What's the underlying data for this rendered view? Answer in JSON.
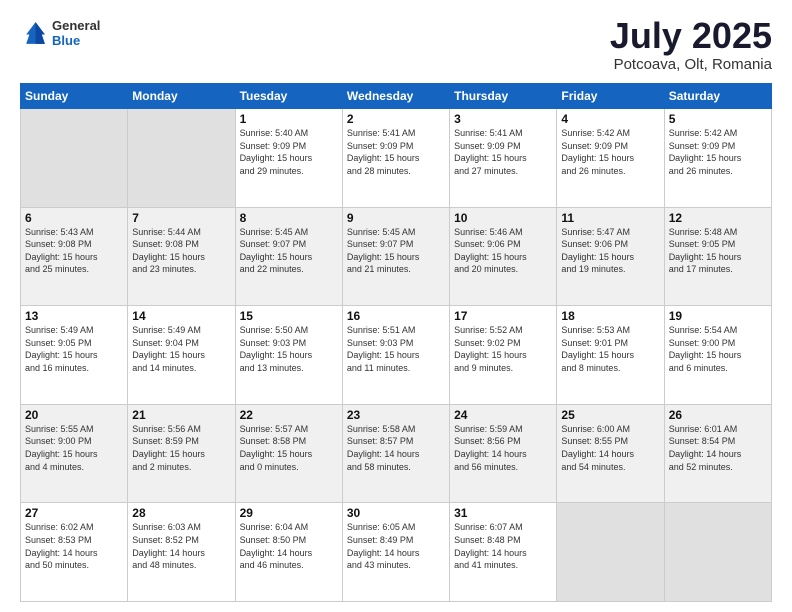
{
  "header": {
    "logo_general": "General",
    "logo_blue": "Blue",
    "month": "July 2025",
    "location": "Potcoava, Olt, Romania"
  },
  "weekdays": [
    "Sunday",
    "Monday",
    "Tuesday",
    "Wednesday",
    "Thursday",
    "Friday",
    "Saturday"
  ],
  "weeks": [
    [
      {
        "day": "",
        "info": ""
      },
      {
        "day": "",
        "info": ""
      },
      {
        "day": "1",
        "info": "Sunrise: 5:40 AM\nSunset: 9:09 PM\nDaylight: 15 hours\nand 29 minutes."
      },
      {
        "day": "2",
        "info": "Sunrise: 5:41 AM\nSunset: 9:09 PM\nDaylight: 15 hours\nand 28 minutes."
      },
      {
        "day": "3",
        "info": "Sunrise: 5:41 AM\nSunset: 9:09 PM\nDaylight: 15 hours\nand 27 minutes."
      },
      {
        "day": "4",
        "info": "Sunrise: 5:42 AM\nSunset: 9:09 PM\nDaylight: 15 hours\nand 26 minutes."
      },
      {
        "day": "5",
        "info": "Sunrise: 5:42 AM\nSunset: 9:09 PM\nDaylight: 15 hours\nand 26 minutes."
      }
    ],
    [
      {
        "day": "6",
        "info": "Sunrise: 5:43 AM\nSunset: 9:08 PM\nDaylight: 15 hours\nand 25 minutes."
      },
      {
        "day": "7",
        "info": "Sunrise: 5:44 AM\nSunset: 9:08 PM\nDaylight: 15 hours\nand 23 minutes."
      },
      {
        "day": "8",
        "info": "Sunrise: 5:45 AM\nSunset: 9:07 PM\nDaylight: 15 hours\nand 22 minutes."
      },
      {
        "day": "9",
        "info": "Sunrise: 5:45 AM\nSunset: 9:07 PM\nDaylight: 15 hours\nand 21 minutes."
      },
      {
        "day": "10",
        "info": "Sunrise: 5:46 AM\nSunset: 9:06 PM\nDaylight: 15 hours\nand 20 minutes."
      },
      {
        "day": "11",
        "info": "Sunrise: 5:47 AM\nSunset: 9:06 PM\nDaylight: 15 hours\nand 19 minutes."
      },
      {
        "day": "12",
        "info": "Sunrise: 5:48 AM\nSunset: 9:05 PM\nDaylight: 15 hours\nand 17 minutes."
      }
    ],
    [
      {
        "day": "13",
        "info": "Sunrise: 5:49 AM\nSunset: 9:05 PM\nDaylight: 15 hours\nand 16 minutes."
      },
      {
        "day": "14",
        "info": "Sunrise: 5:49 AM\nSunset: 9:04 PM\nDaylight: 15 hours\nand 14 minutes."
      },
      {
        "day": "15",
        "info": "Sunrise: 5:50 AM\nSunset: 9:03 PM\nDaylight: 15 hours\nand 13 minutes."
      },
      {
        "day": "16",
        "info": "Sunrise: 5:51 AM\nSunset: 9:03 PM\nDaylight: 15 hours\nand 11 minutes."
      },
      {
        "day": "17",
        "info": "Sunrise: 5:52 AM\nSunset: 9:02 PM\nDaylight: 15 hours\nand 9 minutes."
      },
      {
        "day": "18",
        "info": "Sunrise: 5:53 AM\nSunset: 9:01 PM\nDaylight: 15 hours\nand 8 minutes."
      },
      {
        "day": "19",
        "info": "Sunrise: 5:54 AM\nSunset: 9:00 PM\nDaylight: 15 hours\nand 6 minutes."
      }
    ],
    [
      {
        "day": "20",
        "info": "Sunrise: 5:55 AM\nSunset: 9:00 PM\nDaylight: 15 hours\nand 4 minutes."
      },
      {
        "day": "21",
        "info": "Sunrise: 5:56 AM\nSunset: 8:59 PM\nDaylight: 15 hours\nand 2 minutes."
      },
      {
        "day": "22",
        "info": "Sunrise: 5:57 AM\nSunset: 8:58 PM\nDaylight: 15 hours\nand 0 minutes."
      },
      {
        "day": "23",
        "info": "Sunrise: 5:58 AM\nSunset: 8:57 PM\nDaylight: 14 hours\nand 58 minutes."
      },
      {
        "day": "24",
        "info": "Sunrise: 5:59 AM\nSunset: 8:56 PM\nDaylight: 14 hours\nand 56 minutes."
      },
      {
        "day": "25",
        "info": "Sunrise: 6:00 AM\nSunset: 8:55 PM\nDaylight: 14 hours\nand 54 minutes."
      },
      {
        "day": "26",
        "info": "Sunrise: 6:01 AM\nSunset: 8:54 PM\nDaylight: 14 hours\nand 52 minutes."
      }
    ],
    [
      {
        "day": "27",
        "info": "Sunrise: 6:02 AM\nSunset: 8:53 PM\nDaylight: 14 hours\nand 50 minutes."
      },
      {
        "day": "28",
        "info": "Sunrise: 6:03 AM\nSunset: 8:52 PM\nDaylight: 14 hours\nand 48 minutes."
      },
      {
        "day": "29",
        "info": "Sunrise: 6:04 AM\nSunset: 8:50 PM\nDaylight: 14 hours\nand 46 minutes."
      },
      {
        "day": "30",
        "info": "Sunrise: 6:05 AM\nSunset: 8:49 PM\nDaylight: 14 hours\nand 43 minutes."
      },
      {
        "day": "31",
        "info": "Sunrise: 6:07 AM\nSunset: 8:48 PM\nDaylight: 14 hours\nand 41 minutes."
      },
      {
        "day": "",
        "info": ""
      },
      {
        "day": "",
        "info": ""
      }
    ]
  ]
}
